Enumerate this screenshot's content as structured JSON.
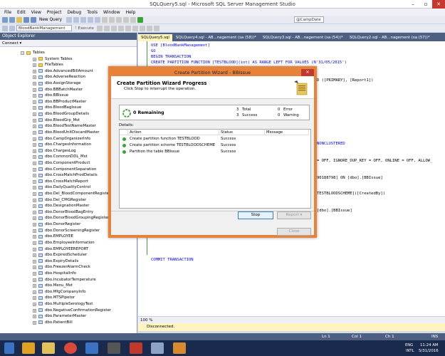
{
  "window": {
    "title": "SQLQuery5.sql - Microsoft SQL Server Management Studio"
  },
  "menu": [
    "File",
    "Edit",
    "View",
    "Project",
    "Debug",
    "Tools",
    "Window",
    "Help"
  ],
  "toolbar": {
    "new_query_label": "New Query",
    "db_combo": "BloodBankManagement",
    "execute_label": "Execute",
    "param_combo": "@CampDate"
  },
  "object_explorer": {
    "title": "Object Explorer",
    "connect_label": "Connect ▾",
    "tables_label": "Tables",
    "folders": [
      "System Tables",
      "FileTables"
    ],
    "tables": [
      "dbo.AdvancedBillAmount",
      "dbo.AdverseReaction",
      "dbo.AssignStorage",
      "dbo.BBBatchMaster",
      "dbo.BBIssue",
      "dbo.BBProductMaster",
      "dbo.BloodBagIssue",
      "dbo.BloodGroupDetails",
      "dbo.BloodGrp_Mst",
      "dbo.BloodTestNameMaster",
      "dbo.BloodUnitDiscardMaster",
      "dbo.CampOrganizerInfo",
      "dbo.ChargesInformation",
      "dbo.ChargesLog",
      "dbo.CommonDDL_Mst",
      "dbo.ComponentProduct",
      "dbo.ComponentSeparation",
      "dbo.CrossMatchProdDetails",
      "dbo.CrossMatchReport",
      "dbo.DailyQualityControl",
      "dbo.Del_BloodComponentRegister",
      "dbo.Del_CMGRegister",
      "dbo.DesignationMaster",
      "dbo.DonorBloodBagEntry",
      "dbo.DonorBloodGroupingRegister",
      "dbo.DonorRegister",
      "dbo.DonorScreeningRegister",
      "dbo.EMPLOYEE",
      "dbo.EmployeeInformation",
      "dbo.EMPLOYEEREPORT",
      "dbo.ExpiredScheduler",
      "dbo.ExpiryDetails",
      "dbo.FreezerAlarmCheck",
      "dbo.HospitalInfo",
      "dbo.IncubatorTemperature",
      "dbo.Menu_Mst",
      "dbo.MfgCompanyInfo",
      "dbo.MTSPipetor",
      "dbo.MultipleSerologyTest",
      "dbo.NegativeConfirmationRegister",
      "dbo.ParameterMaster",
      "dbo.PatientBill"
    ]
  },
  "tabs": [
    "SQLQuery5.sql",
    "SQLQuery4.sql - AB...nagement (sa (58))*",
    "SQLQuery3.sql - AB...nagement (sa (54))*",
    "SQLQuery2.sql - AB...nagement (sa (57))*"
  ],
  "code": {
    "l1": "USE [BloodBankManagement]",
    "l2": "GO",
    "l3": "BEGIN TRANSACTION",
    "l4a": "CREATE PARTITION FUNCTION [TESTBLOOD](int) AS RANGE LEFT FOR VALUES (N'31/05/2015')",
    "l5": "D ([PRIMARY], [Report1])",
    "l6": "NONCLUSTERED",
    "l7": "= OFF, IGNORE_DUP_KEY = OFF, ONLINE = OFF, ALLOW_",
    "l8": "90188798] ON [dbo].[BBIssue]",
    "l9": "TESTBLOODSCHEME]([CreatedBy])",
    "l10": "[dbo].[BBIssue]",
    "l11": "COMMIT TRANSACTION"
  },
  "editor_status": {
    "zoom": "100 %",
    "message": "Disconnected."
  },
  "statusbar": {
    "ln": "Ln 1",
    "col": "Col 1",
    "ch": "Ch 1",
    "mode": "INS"
  },
  "taskbar": {
    "lang": "ENG",
    "region": "INTL",
    "time": "11:24 AM",
    "date": "5/31/2016"
  },
  "dialog": {
    "title": "Create Partition Wizard - BBIssue",
    "heading": "Create Partition Wizard Progress",
    "subheading": "Click Stop to interrupt the operation.",
    "remaining": "0  Remaining",
    "total_n": "3",
    "total_label": "Total",
    "success_n": "3",
    "success_label": "Success",
    "error_n": "0",
    "error_label": "Error",
    "warning_n": "0",
    "warning_label": "Warning",
    "details_label": "Details:",
    "columns": [
      "Action",
      "Status",
      "Message"
    ],
    "rows": [
      {
        "action": "Create partition function TESTBLOOD",
        "status": "Success",
        "message": ""
      },
      {
        "action": "Create partition scheme TESTBLOODSCHEME",
        "status": "Success",
        "message": ""
      },
      {
        "action": "Partition the table BBIssue",
        "status": "Success",
        "message": ""
      }
    ],
    "stop_label": "Stop",
    "report_label": "Report",
    "close_label": "Close"
  }
}
